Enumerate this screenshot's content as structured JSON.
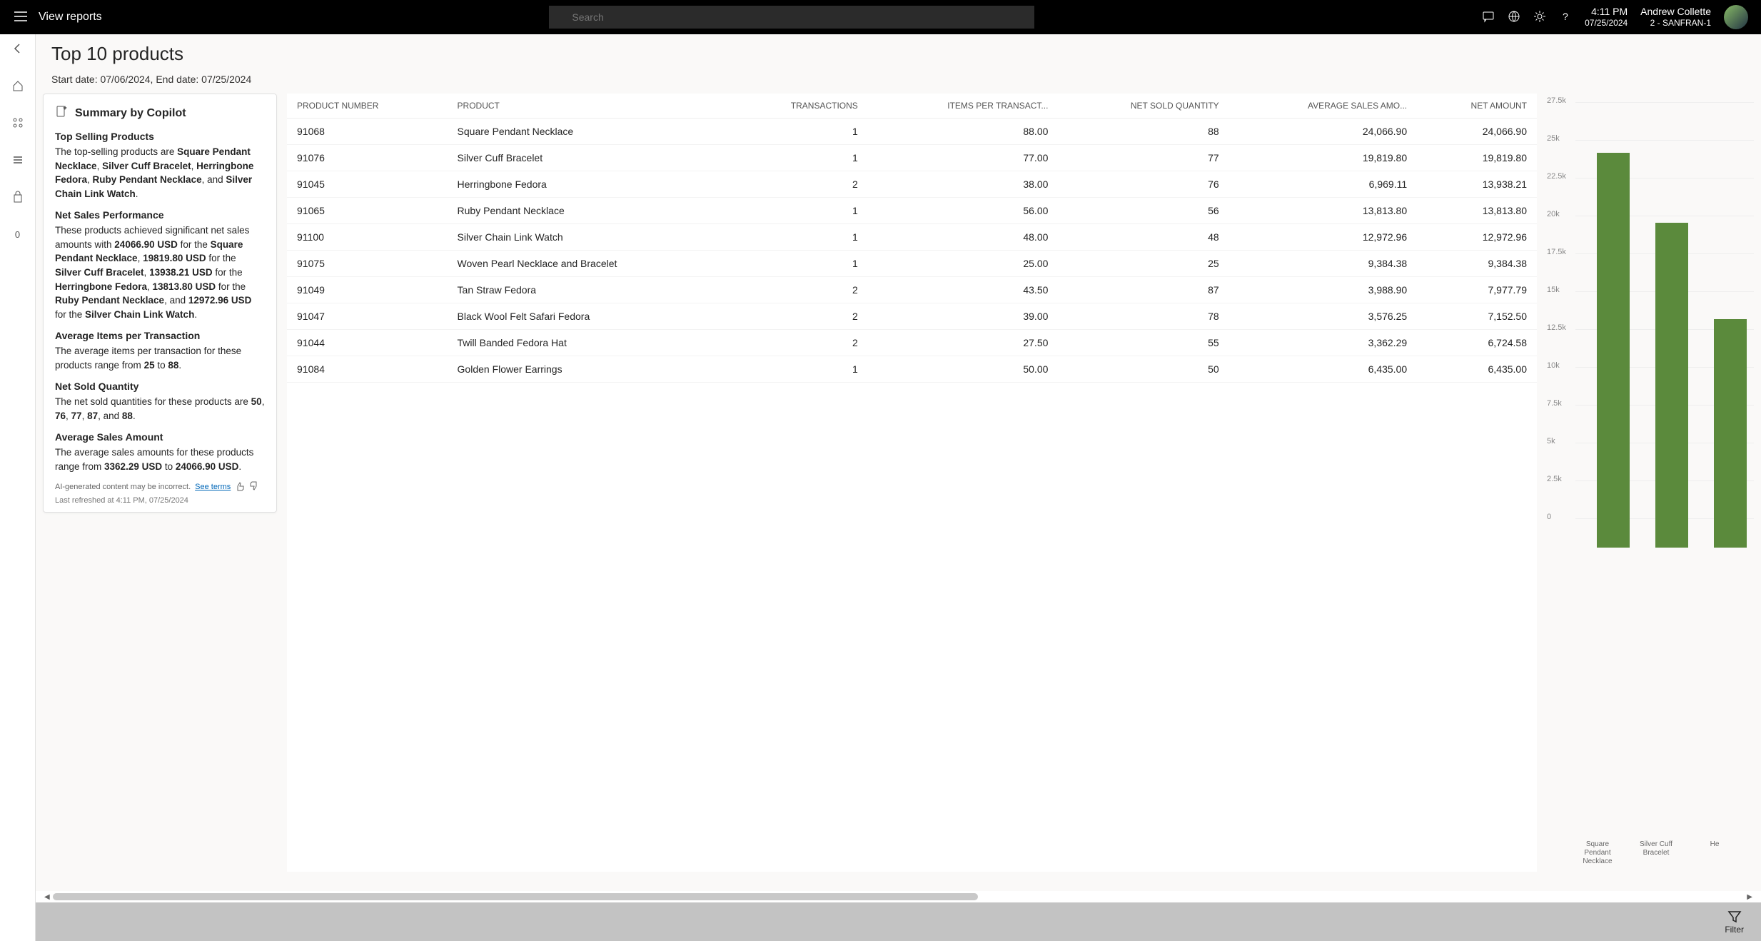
{
  "header": {
    "app_title": "View reports",
    "search_placeholder": "Search",
    "time": "4:11 PM",
    "date": "07/25/2024",
    "user_name": "Andrew Collette",
    "user_sub": "2 - SANFRAN-1"
  },
  "leftnav": {
    "back": "←",
    "home": "⌂",
    "dash": "◫",
    "list": "≡",
    "bag": "🛍",
    "count": "0"
  },
  "page": {
    "title": "Top 10 products",
    "date_range": "Start date: 07/06/2024, End date: 07/25/2024"
  },
  "copilot": {
    "heading": "Summary by Copilot",
    "sections": [
      {
        "title": "Top Selling Products",
        "body_html": "The top-selling products are <b>Square Pendant Necklace</b>, <b>Silver Cuff Bracelet</b>, <b>Herringbone Fedora</b>, <b>Ruby Pendant Necklace</b>, and <b>Silver Chain Link Watch</b>."
      },
      {
        "title": "Net Sales Performance",
        "body_html": "These products achieved significant net sales amounts with <b>24066.90 USD</b> for the <b>Square Pendant Necklace</b>, <b>19819.80 USD</b> for the <b>Silver Cuff Bracelet</b>, <b>13938.21 USD</b> for the <b>Herringbone Fedora</b>, <b>13813.80 USD</b> for the <b>Ruby Pendant Necklace</b>, and <b>12972.96 USD</b> for the <b>Silver Chain Link Watch</b>."
      },
      {
        "title": "Average Items per Transaction",
        "body_html": "The average items per transaction for these products range from <b>25</b> to <b>88</b>."
      },
      {
        "title": "Net Sold Quantity",
        "body_html": "The net sold quantities for these products are <b>50</b>, <b>76</b>, <b>77</b>, <b>87</b>, and <b>88</b>."
      },
      {
        "title": "Average Sales Amount",
        "body_html": "The average sales amounts for these products range from <b>3362.29 USD</b> to <b>24066.90 USD</b>."
      }
    ],
    "ai_note": "AI-generated content may be incorrect.",
    "see_terms": "See terms",
    "refreshed": "Last refreshed at 4:11 PM, 07/25/2024"
  },
  "table": {
    "columns": [
      "PRODUCT NUMBER",
      "PRODUCT",
      "TRANSACTIONS",
      "ITEMS PER TRANSACT...",
      "NET SOLD QUANTITY",
      "AVERAGE SALES AMO...",
      "NET AMOUNT"
    ],
    "rows": [
      [
        "91068",
        "Square Pendant Necklace",
        "1",
        "88.00",
        "88",
        "24,066.90",
        "24,066.90"
      ],
      [
        "91076",
        "Silver Cuff Bracelet",
        "1",
        "77.00",
        "77",
        "19,819.80",
        "19,819.80"
      ],
      [
        "91045",
        "Herringbone Fedora",
        "2",
        "38.00",
        "76",
        "6,969.11",
        "13,938.21"
      ],
      [
        "91065",
        "Ruby Pendant Necklace",
        "1",
        "56.00",
        "56",
        "13,813.80",
        "13,813.80"
      ],
      [
        "91100",
        "Silver Chain Link Watch",
        "1",
        "48.00",
        "48",
        "12,972.96",
        "12,972.96"
      ],
      [
        "91075",
        "Woven Pearl Necklace and Bracelet",
        "1",
        "25.00",
        "25",
        "9,384.38",
        "9,384.38"
      ],
      [
        "91049",
        "Tan Straw Fedora",
        "2",
        "43.50",
        "87",
        "3,988.90",
        "7,977.79"
      ],
      [
        "91047",
        "Black Wool Felt Safari Fedora",
        "2",
        "39.00",
        "78",
        "3,576.25",
        "7,152.50"
      ],
      [
        "91044",
        "Twill Banded Fedora Hat",
        "2",
        "27.50",
        "55",
        "3,362.29",
        "6,724.58"
      ],
      [
        "91084",
        "Golden Flower Earrings",
        "1",
        "50.00",
        "50",
        "6,435.00",
        "6,435.00"
      ]
    ]
  },
  "chart_data": {
    "type": "bar",
    "title": "",
    "ylabel": "",
    "ylim": [
      0,
      27500
    ],
    "yticks": [
      "27.5k",
      "25k",
      "22.5k",
      "20k",
      "17.5k",
      "15k",
      "12.5k",
      "10k",
      "7.5k",
      "5k",
      "2.5k",
      "0"
    ],
    "categories": [
      "Square Pendant Necklace",
      "Silver Cuff Bracelet",
      "He"
    ],
    "values": [
      24066.9,
      19819.8,
      13938.21
    ],
    "bar_color": "#5b8a3c"
  },
  "footer": {
    "filter": "Filter"
  }
}
